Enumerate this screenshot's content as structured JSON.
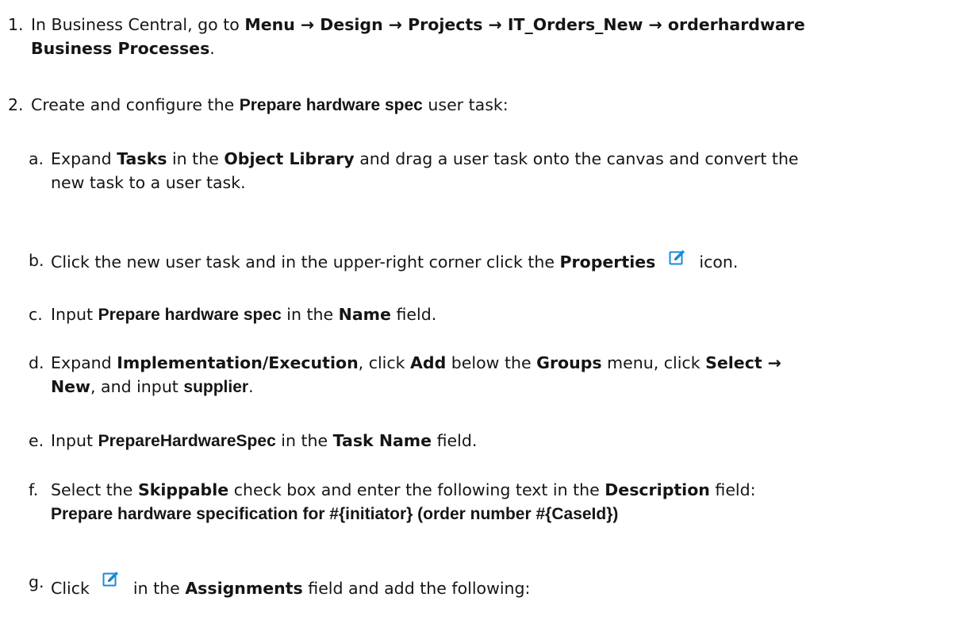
{
  "step1": {
    "number": "1.",
    "prefix": "In Business Central, go to",
    "path": "Menu → Design → Projects → IT_Orders_New → orderhardware",
    "path2": "Business Processes",
    "suffix": "."
  },
  "step2": {
    "number": "2.",
    "prefix": "Create and configure the",
    "task_name": "Prepare hardware spec",
    "suffix": "user task:"
  },
  "substeps": {
    "a": {
      "letter": "a.",
      "t1": "Expand",
      "tasks": "Tasks",
      "t2": "in the",
      "library": "Object Library",
      "t3": "and drag a user task onto the canvas and convert the",
      "line2": "new task to a user task."
    },
    "b": {
      "letter": "b.",
      "t1": "Click the new user task and in the upper-right corner click the",
      "properties": "Properties",
      "t2": "icon."
    },
    "c": {
      "letter": "c.",
      "t1": "Input",
      "value": "Prepare hardware spec",
      "t2": "in the",
      "field": "Name",
      "t3": "field."
    },
    "d": {
      "letter": "d.",
      "t1": "Expand",
      "section": "Implementation/Execution",
      "t2": ", click",
      "add": "Add",
      "t3": "below the",
      "groups": "Groups",
      "t4": "menu, click",
      "select": "Select →",
      "new": "New",
      "t5": ", and input",
      "supplier": "supplier",
      "t6": "."
    },
    "e": {
      "letter": "e.",
      "t1": "Input",
      "value": "PrepareHardwareSpec",
      "t2": "in the",
      "field": "Task Name",
      "t3": "field."
    },
    "f": {
      "letter": "f.",
      "t1": "Select the",
      "skippable": "Skippable",
      "t2": "check box and enter the following text in the",
      "description": "Description",
      "t3": "field:",
      "text": "Prepare hardware specification for #{initiator} (order number #{CaseId})"
    },
    "g": {
      "letter": "g.",
      "t1": "Click",
      "t2": "in the",
      "assignments": "Assignments",
      "t3": "field and add the following:"
    }
  },
  "icons": {
    "edit_icon": "edit-icon",
    "edit_color": "#1a8ad8"
  }
}
